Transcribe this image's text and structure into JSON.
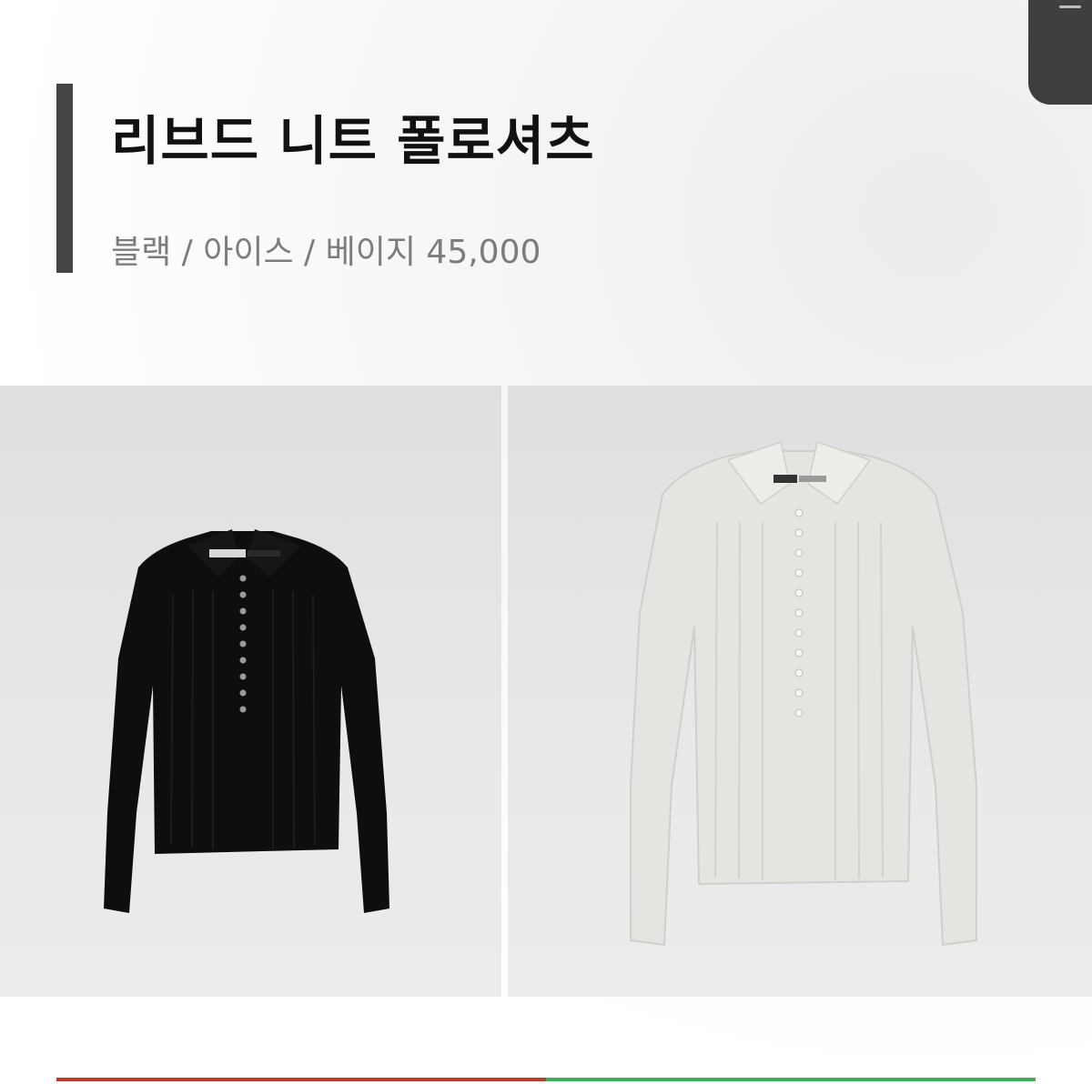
{
  "product": {
    "title": "리브드 니트 폴로셔츠",
    "subtitle": "블랙 / 아이스 / 베이지 45,000"
  },
  "photos": [
    {
      "color": "#0d0d0d",
      "name": "black-polo-photo"
    },
    {
      "color": "#e6e6e3",
      "name": "ice-polo-photo"
    }
  ],
  "colors": {
    "accent_bar": "#454545",
    "line_red": "#c0392b",
    "line_green": "#3cae5a"
  }
}
